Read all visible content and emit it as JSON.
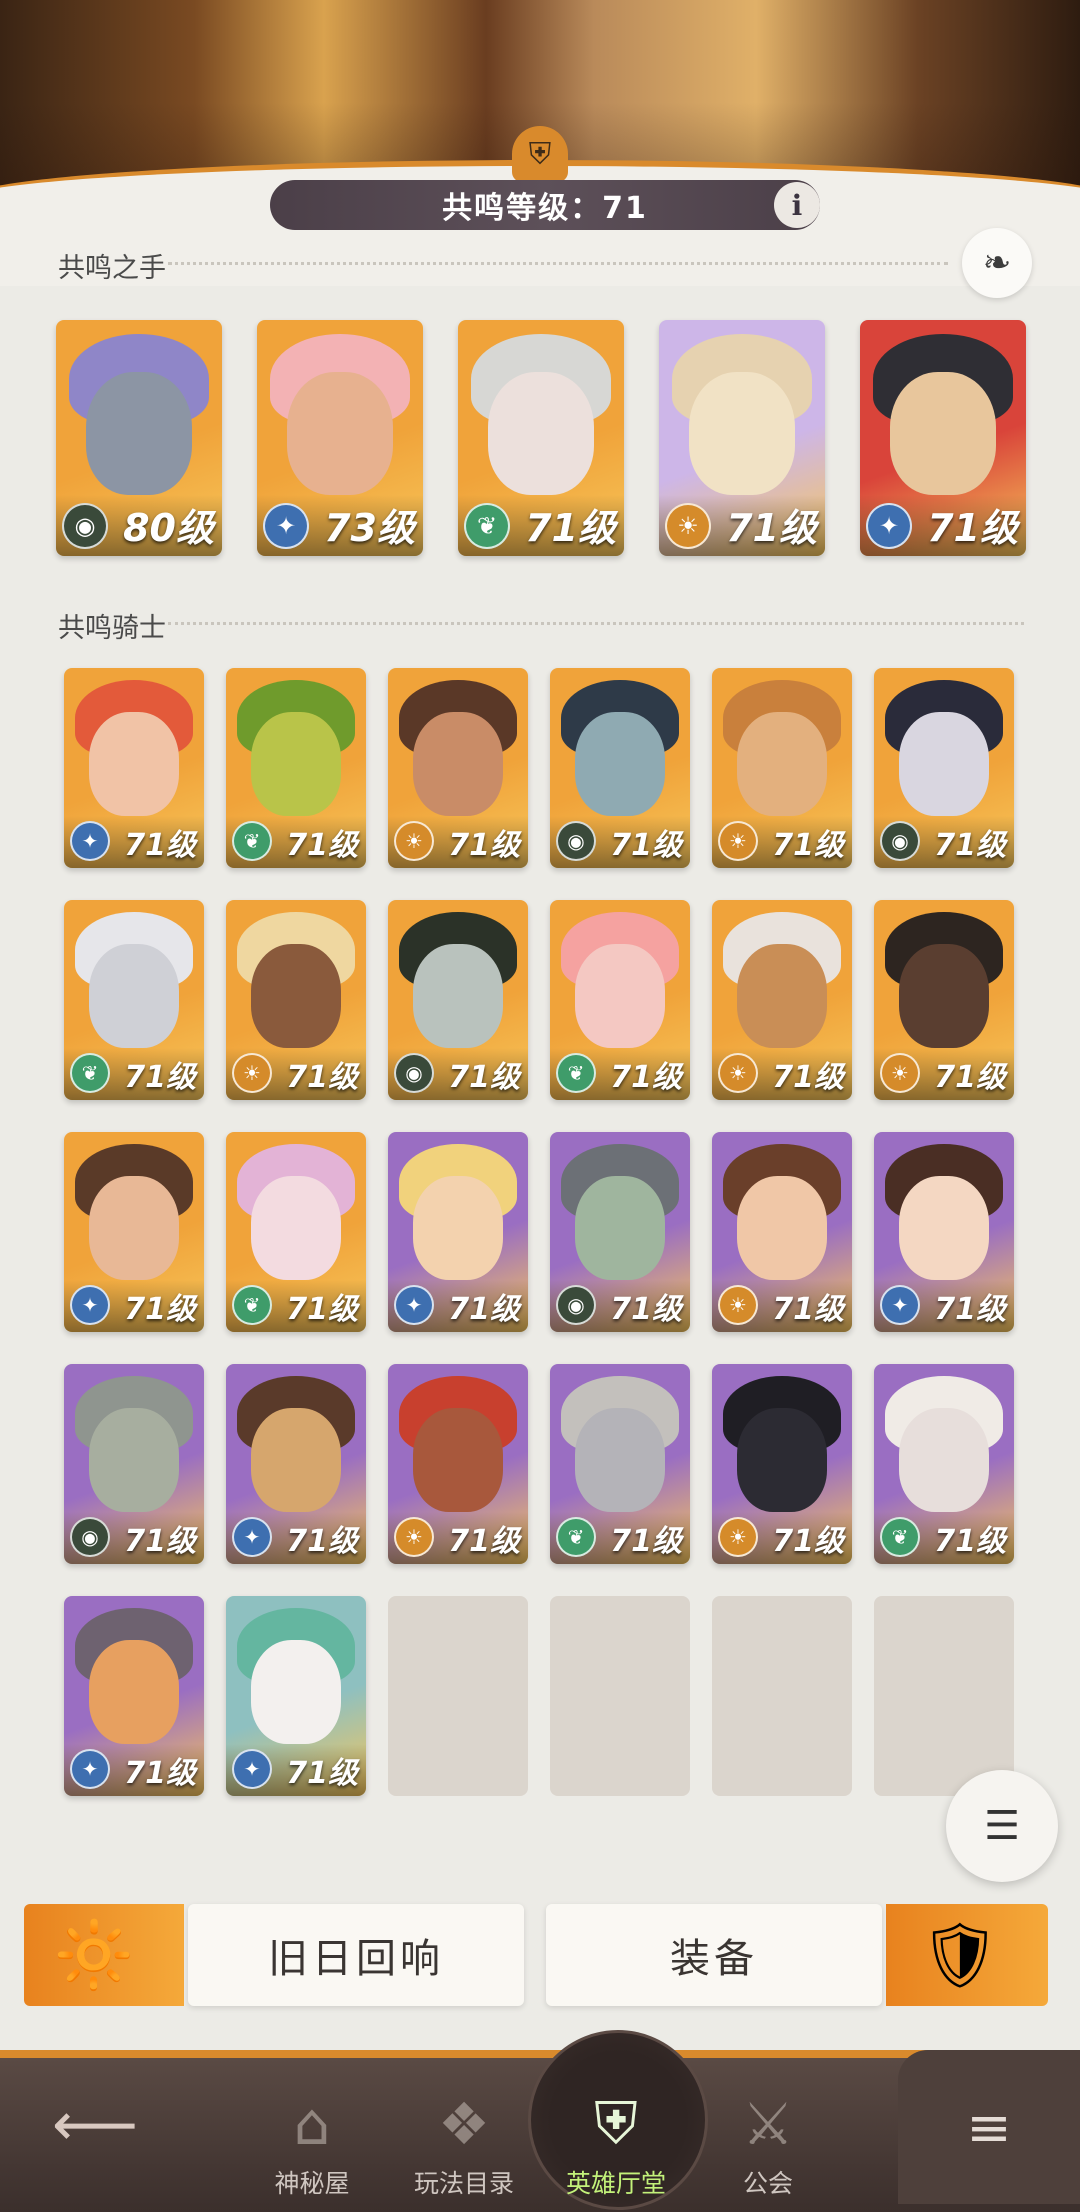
{
  "header": {
    "level_text": "共鸣等级：71"
  },
  "sections": {
    "hands_title": "共鸣之手",
    "knights_title": "共鸣骑士"
  },
  "hands": [
    {
      "level": "80级",
      "faction": "graveborn",
      "hair": "#8f86c8",
      "skin": "#8c95a4",
      "bg": "#f0a33a"
    },
    {
      "level": "73级",
      "faction": "celestial",
      "hair": "#f3b2b4",
      "skin": "#e7b18f",
      "bg": "#f0a33a"
    },
    {
      "level": "71级",
      "faction": "wilder",
      "hair": "#d7d7d4",
      "skin": "#ece0dc",
      "bg": "#f0a33a"
    },
    {
      "level": "71级",
      "faction": "lightbearer",
      "hair": "#e6d2b0",
      "skin": "#f1e2c5",
      "bg": "#cdb6e8"
    },
    {
      "level": "71级",
      "faction": "celestial",
      "hair": "#2f2e34",
      "skin": "#e8c69c",
      "bg": "#d9443a"
    }
  ],
  "knights": [
    {
      "level": "71级",
      "faction": "celestial",
      "hair": "#e35a3a",
      "skin": "#f1c3a6",
      "bg": "#f0a33a"
    },
    {
      "level": "71级",
      "faction": "wilder",
      "hair": "#6f9b2c",
      "skin": "#b9c449",
      "bg": "#f0a33a"
    },
    {
      "level": "71级",
      "faction": "lightbearer",
      "hair": "#5a3827",
      "skin": "#c98c67",
      "bg": "#f0a33a"
    },
    {
      "level": "71级",
      "faction": "graveborn",
      "hair": "#2e3a48",
      "skin": "#8faab2",
      "bg": "#f0a33a"
    },
    {
      "level": "71级",
      "faction": "lightbearer",
      "hair": "#c9803c",
      "skin": "#e3b07e",
      "bg": "#f0a33a"
    },
    {
      "level": "71级",
      "faction": "graveborn",
      "hair": "#2a2b3a",
      "skin": "#d9d6e0",
      "bg": "#f0a33a"
    },
    {
      "level": "71级",
      "faction": "wilder",
      "hair": "#e6e6ea",
      "skin": "#cfd0d6",
      "bg": "#f0a33a"
    },
    {
      "level": "71级",
      "faction": "lightbearer",
      "hair": "#efd7a0",
      "skin": "#8a5a3c",
      "bg": "#f0a33a"
    },
    {
      "level": "71级",
      "faction": "graveborn",
      "hair": "#2b3228",
      "skin": "#b9c2bd",
      "bg": "#f0a33a"
    },
    {
      "level": "71级",
      "faction": "wilder",
      "hair": "#f5a2a0",
      "skin": "#f4c8c2",
      "bg": "#f0a33a"
    },
    {
      "level": "71级",
      "faction": "lightbearer",
      "hair": "#e9e2dc",
      "skin": "#c98e56",
      "bg": "#f0a33a"
    },
    {
      "level": "71级",
      "faction": "lightbearer",
      "hair": "#2d2520",
      "skin": "#5a3e30",
      "bg": "#f0a33a"
    },
    {
      "level": "71级",
      "faction": "celestial",
      "hair": "#5a3a28",
      "skin": "#e8b896",
      "bg": "#f0a33a"
    },
    {
      "level": "71级",
      "faction": "wilder",
      "hair": "#e3b3d6",
      "skin": "#f3dbe0",
      "bg": "#f0a33a"
    },
    {
      "level": "71级",
      "faction": "celestial",
      "hair": "#f1d27c",
      "skin": "#f3d2ae",
      "bg": "#9a6ec2"
    },
    {
      "level": "71级",
      "faction": "graveborn",
      "hair": "#6c7076",
      "skin": "#9fb59e",
      "bg": "#9a6ec2"
    },
    {
      "level": "71级",
      "faction": "lightbearer",
      "hair": "#6a3f2a",
      "skin": "#f0c7a7",
      "bg": "#9a6ec2"
    },
    {
      "level": "71级",
      "faction": "celestial",
      "hair": "#4a2e24",
      "skin": "#f4d7c2",
      "bg": "#9a6ec2"
    },
    {
      "level": "71级",
      "faction": "graveborn",
      "hair": "#8f958f",
      "skin": "#a7ae9f",
      "bg": "#9a6ec2"
    },
    {
      "level": "71级",
      "faction": "celestial",
      "hair": "#5a3a2a",
      "skin": "#d6a66d",
      "bg": "#9a6ec2"
    },
    {
      "level": "71级",
      "faction": "lightbearer",
      "hair": "#c8402e",
      "skin": "#a8583c",
      "bg": "#9a6ec2"
    },
    {
      "level": "71级",
      "faction": "wilder",
      "hair": "#c3c0bc",
      "skin": "#b4b3b8",
      "bg": "#9a6ec2"
    },
    {
      "level": "71级",
      "faction": "lightbearer",
      "hair": "#1f1e24",
      "skin": "#2c2b33",
      "bg": "#9a6ec2"
    },
    {
      "level": "71级",
      "faction": "wilder",
      "hair": "#f0ebe6",
      "skin": "#e7dedb",
      "bg": "#9a6ec2"
    },
    {
      "level": "71级",
      "faction": "celestial",
      "hair": "#6e6270",
      "skin": "#e7a060",
      "bg": "#9a6ec2"
    },
    {
      "level": "71级",
      "faction": "celestial",
      "hair": "#64b6a0",
      "skin": "#f3f0ee",
      "bg": "#8ec0c0"
    }
  ],
  "faction_colors": {
    "celestial": "#3e6fb0",
    "wilder": "#3f9c6a",
    "lightbearer": "#d58b2a",
    "graveborn": "#3a4a3a"
  },
  "faction_icons": {
    "celestial": "✦",
    "wilder": "❦",
    "lightbearer": "☀",
    "graveborn": "◉"
  },
  "buttons": {
    "echoes_label": "旧日回响",
    "equipment_label": "装备"
  },
  "nav": {
    "items": [
      {
        "label": "神秘屋",
        "icon": "⌂"
      },
      {
        "label": "玩法目录",
        "icon": "❖"
      },
      {
        "label": "英雄厅堂",
        "icon": "⛨"
      },
      {
        "label": "公会",
        "icon": "⚔"
      }
    ]
  },
  "colors": {
    "accent": "#d98a2c",
    "active_nav": "#c3f27a"
  }
}
